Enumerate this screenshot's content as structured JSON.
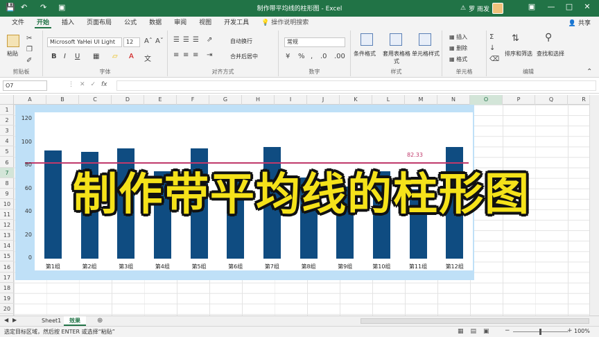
{
  "window": {
    "title": "制作带平均线的柱形图 - Excel",
    "user": "罗 雨发",
    "quick_access": [
      "save-icon",
      "undo-icon",
      "redo-icon",
      "touch-mode-icon"
    ],
    "controls": [
      "minimize",
      "restore",
      "close"
    ]
  },
  "ribbon_tabs": [
    "文件",
    "开始",
    "插入",
    "页面布局",
    "公式",
    "数据",
    "审阅",
    "视图",
    "开发工具"
  ],
  "active_tab": "开始",
  "search_tab": "操作说明搜索",
  "share_label": "共享",
  "ribbon": {
    "clipboard": {
      "paste": "粘贴",
      "label": "剪贴板"
    },
    "font": {
      "name": "Microsoft YaHei UI Light",
      "size": "12",
      "label": "字体"
    },
    "alignment": {
      "wrap": "自动换行",
      "merge": "合并后居中",
      "label": "对齐方式"
    },
    "number": {
      "format": "常规",
      "label": "数字"
    },
    "styles": {
      "conditional": "条件格式",
      "table": "套用表格格式",
      "cell": "单元格样式",
      "label": "样式"
    },
    "cells": {
      "insert": "插入",
      "delete": "删除",
      "format": "格式",
      "label": "单元格"
    },
    "editing": {
      "sort": "排序和筛选",
      "find": "查找和选择",
      "label": "编辑"
    }
  },
  "formula_bar": {
    "name_box": "O7",
    "fx": "fx",
    "value": ""
  },
  "columns": [
    "A",
    "B",
    "C",
    "D",
    "E",
    "F",
    "G",
    "H",
    "I",
    "J",
    "K",
    "L",
    "M",
    "N",
    "O",
    "P",
    "Q",
    "R"
  ],
  "rows": [
    "1",
    "2",
    "3",
    "4",
    "5",
    "6",
    "7",
    "8",
    "9",
    "10",
    "11",
    "12",
    "13",
    "14",
    "15",
    "16",
    "17",
    "18",
    "19",
    "20"
  ],
  "chart_data": {
    "type": "bar",
    "categories": [
      "第1组",
      "第2组",
      "第3组",
      "第4组",
      "第5组",
      "第6组",
      "第7组",
      "第8组",
      "第9组",
      "第10组",
      "第11组",
      "第12组"
    ],
    "series": [
      {
        "values": [
          93,
          92,
          95,
          75,
          95,
          72,
          96,
          70,
          62,
          75,
          60,
          96
        ]
      }
    ],
    "average_line": 82.33,
    "average_label": "82.33",
    "yticks": [
      "0",
      "20",
      "40",
      "60",
      "80",
      "100",
      "120"
    ],
    "ylim": [
      0,
      120
    ],
    "title": "",
    "xlabel": "",
    "ylabel": "",
    "bar_color": "#0f4c81",
    "line_color": "#c0396b",
    "chart_bg": "#bfe0f7"
  },
  "overlay_title": "制作带平均线的柱形图",
  "sheets": [
    "Sheet1",
    "效果"
  ],
  "active_sheet": "效果",
  "status": {
    "message": "选定目标区域，然后按 ENTER 或选择“粘贴”",
    "zoom": "100%"
  }
}
